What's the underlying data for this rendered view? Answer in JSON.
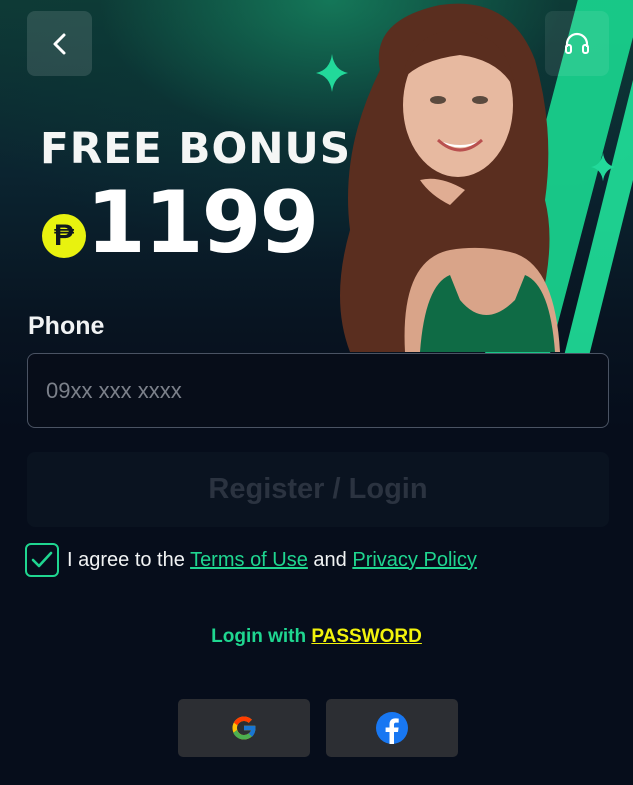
{
  "header": {
    "back_icon": "chevron-left-icon",
    "support_icon": "headset-icon"
  },
  "promo": {
    "title": "FREE BONUS",
    "currency_symbol": "₱",
    "amount": "1199",
    "accent_color": "#1fd690"
  },
  "form": {
    "phone_label": "Phone",
    "phone_placeholder": "09xx xxx xxxx",
    "phone_value": "",
    "submit_label": "Register / Login"
  },
  "agreement": {
    "checked": true,
    "prefix": "I agree to the ",
    "terms_link": "Terms of Use",
    "conjunction": " and ",
    "privacy_link": "Privacy Policy"
  },
  "alt_login": {
    "prefix": "Login with ",
    "method": "PASSWORD",
    "prefix_color": "#1fd690",
    "method_color": "#f2f20c"
  },
  "social": [
    {
      "name": "Google",
      "icon": "google-icon"
    },
    {
      "name": "Facebook",
      "icon": "facebook-icon"
    }
  ]
}
